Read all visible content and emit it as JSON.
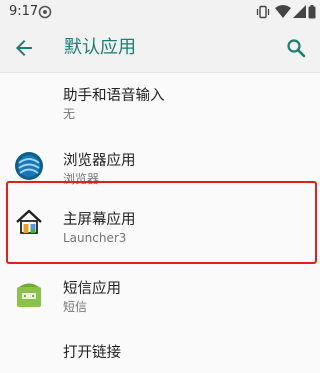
{
  "status": {
    "time": "9:17"
  },
  "appbar": {
    "title": "默认应用"
  },
  "items": [
    {
      "label": "助手和语音输入",
      "sub": "无"
    },
    {
      "label": "浏览器应用",
      "sub": "浏览器"
    },
    {
      "label": "主屏幕应用",
      "sub": "Launcher3"
    },
    {
      "label": "短信应用",
      "sub": "短信"
    },
    {
      "label": "打开链接"
    }
  ],
  "icons": {
    "back": "arrow-back-icon",
    "search": "search-icon",
    "browser": "browser-globe-icon",
    "home": "launcher-house-icon",
    "sms": "sms-android-icon"
  },
  "colors": {
    "accent": "#1a7f74",
    "highlight": "#e11f1f"
  }
}
